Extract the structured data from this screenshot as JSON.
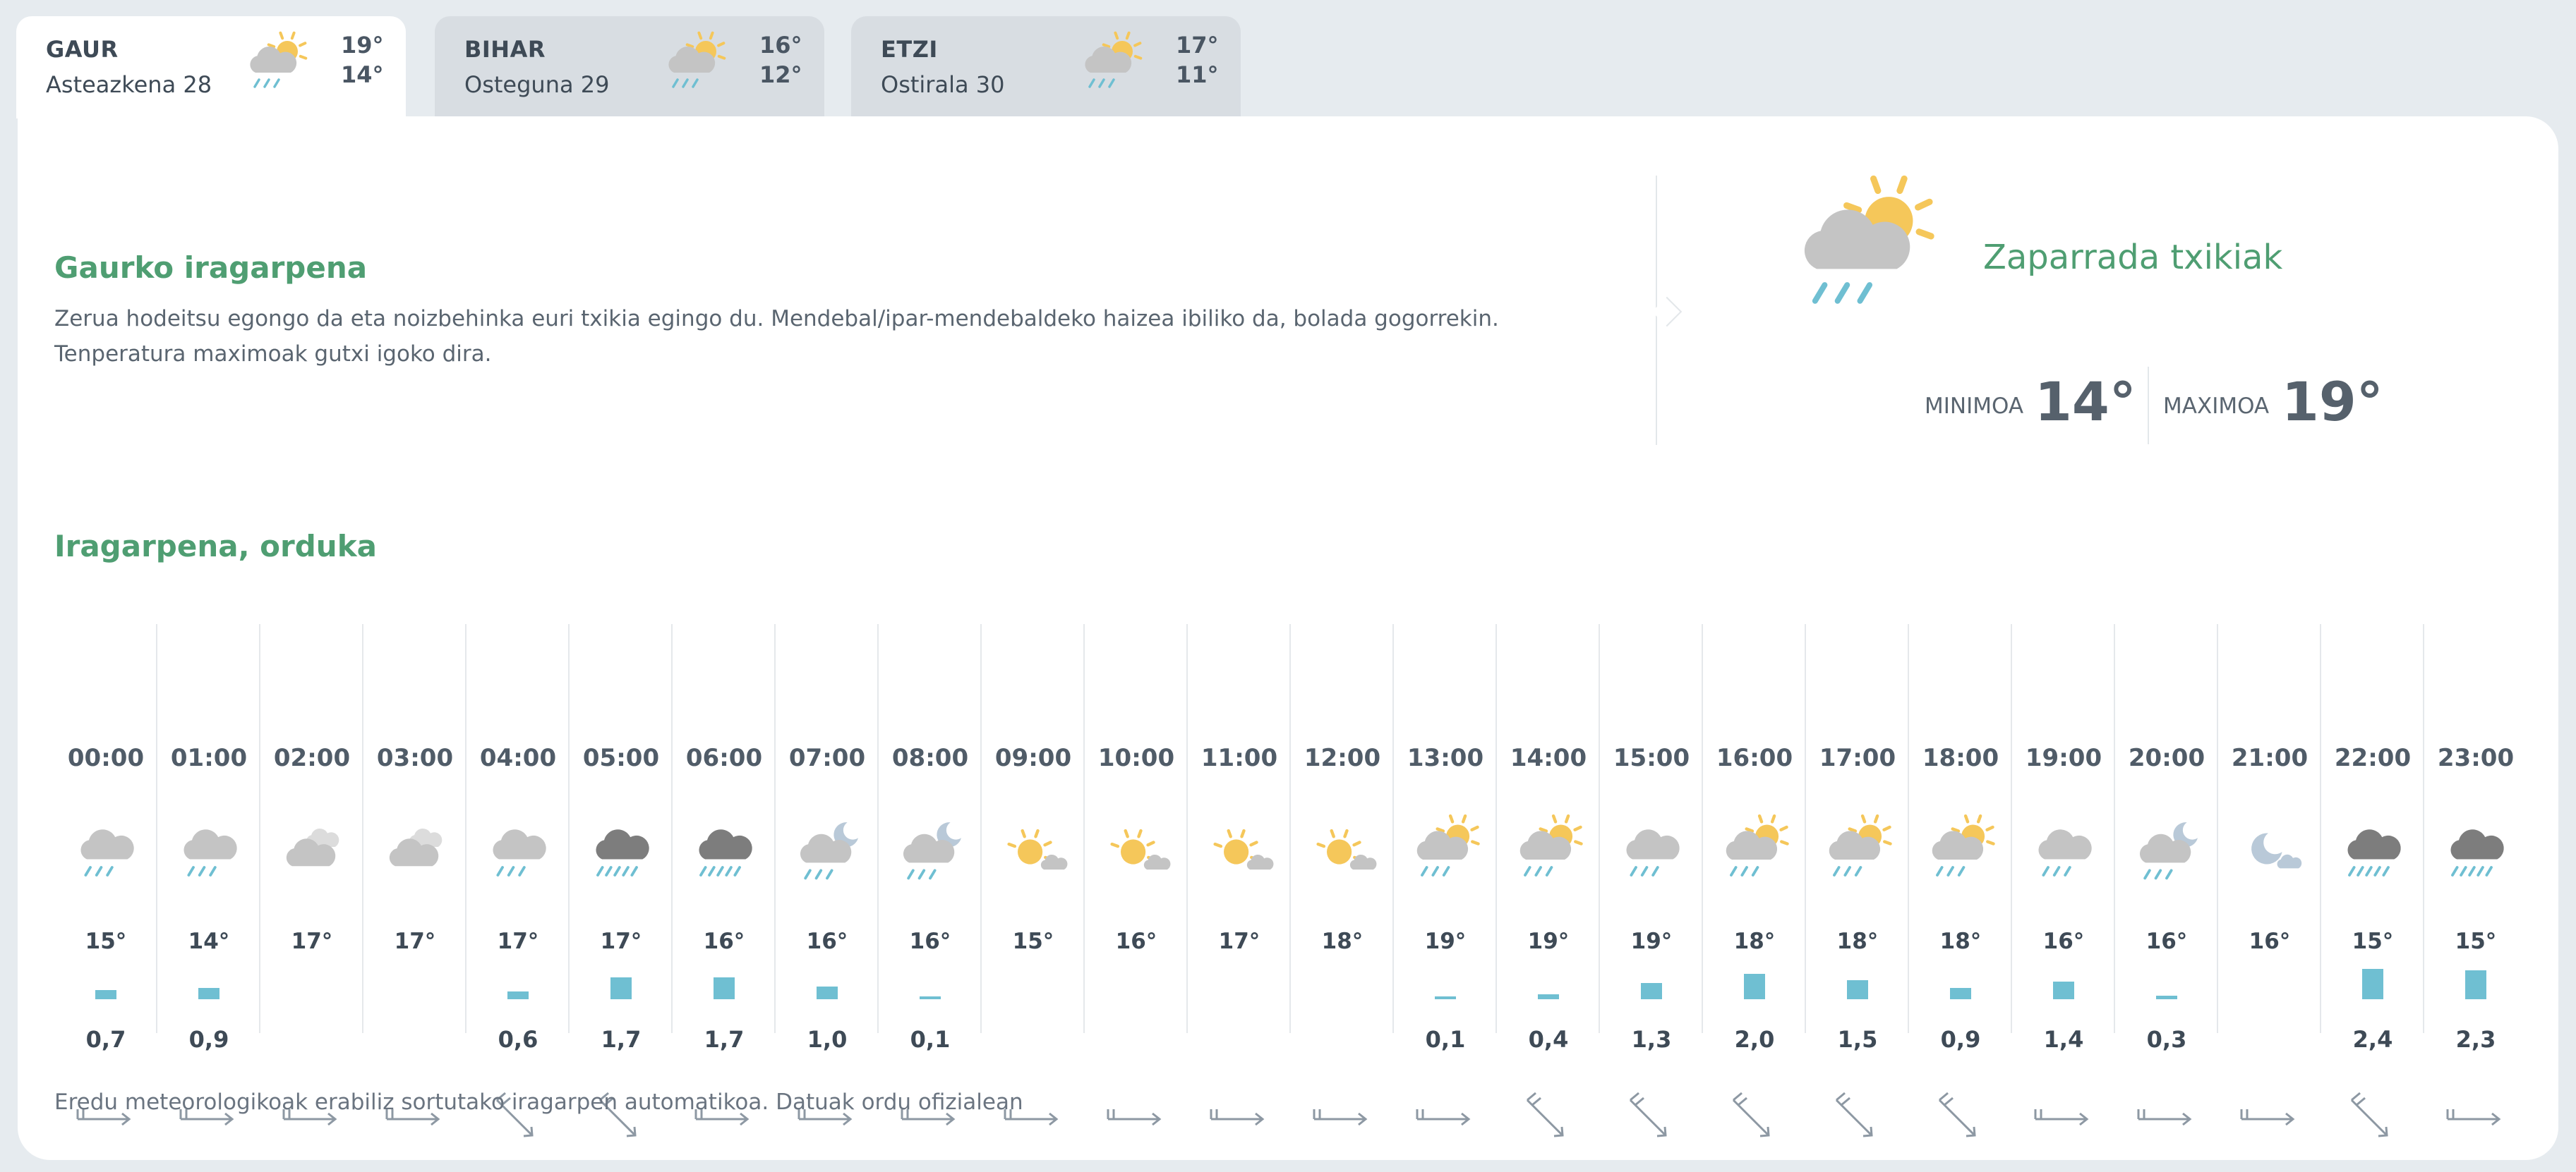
{
  "days": [
    {
      "name": "GAUR",
      "date": "Asteazkena 28",
      "max": "19°",
      "min": "14°",
      "icon": "sun-cloud-rain-icon",
      "active": true
    },
    {
      "name": "BIHAR",
      "date": "Osteguna 29",
      "max": "16°",
      "min": "12°",
      "icon": "sun-cloud-rain-icon",
      "active": false
    },
    {
      "name": "ETZI",
      "date": "Ostirala 30",
      "max": "17°",
      "min": "11°",
      "icon": "sun-cloud-rain-icon",
      "active": false
    }
  ],
  "today": {
    "title": "Gaurko iragarpena",
    "description": "Zerua hodeitsu egongo da eta noizbehinka euri txikia egingo du. Mendebal/ipar-mendebaldeko haizea ibiliko da, bolada gogorrekin. Tenperatura maximoak gutxi igoko dira.",
    "condition": "Zaparrada txikiak",
    "min_label": "MINIMOA",
    "min_value": "14°",
    "max_label": "MAXIMOA",
    "max_value": "19°"
  },
  "hourly_title": "Iragarpena, orduka",
  "hours": [
    {
      "time": "00:00",
      "icon": "cloud-rain-icon",
      "temp": "15°",
      "rain": "0,7",
      "wind": "east"
    },
    {
      "time": "01:00",
      "icon": "cloud-rain-icon",
      "temp": "14°",
      "rain": "0,9",
      "wind": "east"
    },
    {
      "time": "02:00",
      "icon": "clouds-icon",
      "temp": "17°",
      "rain": "",
      "wind": "east"
    },
    {
      "time": "03:00",
      "icon": "clouds-icon",
      "temp": "17°",
      "rain": "",
      "wind": "east"
    },
    {
      "time": "04:00",
      "icon": "cloud-rain-icon",
      "temp": "17°",
      "rain": "0,6",
      "wind": "southeast"
    },
    {
      "time": "05:00",
      "icon": "dark-cloud-heavy-rain-icon",
      "temp": "17°",
      "rain": "1,7",
      "wind": "southeast"
    },
    {
      "time": "06:00",
      "icon": "dark-cloud-heavy-rain-icon",
      "temp": "16°",
      "rain": "1,7",
      "wind": "east"
    },
    {
      "time": "07:00",
      "icon": "moon-cloud-rain-icon",
      "temp": "16°",
      "rain": "1,0",
      "wind": "east"
    },
    {
      "time": "08:00",
      "icon": "moon-cloud-rain-icon",
      "temp": "16°",
      "rain": "0,1",
      "wind": "east"
    },
    {
      "time": "09:00",
      "icon": "sun-small-cloud-icon",
      "temp": "15°",
      "rain": "",
      "wind": "east"
    },
    {
      "time": "10:00",
      "icon": "sun-small-cloud-icon",
      "temp": "16°",
      "rain": "",
      "wind": "east"
    },
    {
      "time": "11:00",
      "icon": "sun-small-cloud-icon",
      "temp": "17°",
      "rain": "",
      "wind": "east"
    },
    {
      "time": "12:00",
      "icon": "sun-small-cloud-icon",
      "temp": "18°",
      "rain": "",
      "wind": "east"
    },
    {
      "time": "13:00",
      "icon": "sun-cloud-rain-icon",
      "temp": "19°",
      "rain": "0,1",
      "wind": "east"
    },
    {
      "time": "14:00",
      "icon": "sun-cloud-rain-icon",
      "temp": "19°",
      "rain": "0,4",
      "wind": "southeast"
    },
    {
      "time": "15:00",
      "icon": "cloud-rain-icon",
      "temp": "19°",
      "rain": "1,3",
      "wind": "southeast"
    },
    {
      "time": "16:00",
      "icon": "sun-cloud-rain-icon",
      "temp": "18°",
      "rain": "2,0",
      "wind": "southeast"
    },
    {
      "time": "17:00",
      "icon": "sun-cloud-rain-icon",
      "temp": "18°",
      "rain": "1,5",
      "wind": "southeast"
    },
    {
      "time": "18:00",
      "icon": "sun-cloud-rain-icon",
      "temp": "18°",
      "rain": "0,9",
      "wind": "southeast"
    },
    {
      "time": "19:00",
      "icon": "cloud-rain-icon",
      "temp": "16°",
      "rain": "1,4",
      "wind": "east"
    },
    {
      "time": "20:00",
      "icon": "moon-cloud-rain-icon",
      "temp": "16°",
      "rain": "0,3",
      "wind": "east"
    },
    {
      "time": "21:00",
      "icon": "moon-small-cloud-icon",
      "temp": "16°",
      "rain": "",
      "wind": "east"
    },
    {
      "time": "22:00",
      "icon": "dark-cloud-heavy-rain-icon",
      "temp": "15°",
      "rain": "2,4",
      "wind": "southeast"
    },
    {
      "time": "23:00",
      "icon": "dark-cloud-heavy-rain-icon",
      "temp": "15°",
      "rain": "2,3",
      "wind": "east"
    }
  ],
  "footer": "Eredu meteorologikoak erabiliz sortutako iragarpen automatikoa. Datuak ordu ofizialean",
  "colors": {
    "accent": "#4f9e72",
    "rain_bar": "#6fbfd2",
    "sun": "#f5c75a",
    "cloud": "#c4c4c4",
    "dark_cloud": "#7d7d7d",
    "moon": "#b9c9d8"
  }
}
